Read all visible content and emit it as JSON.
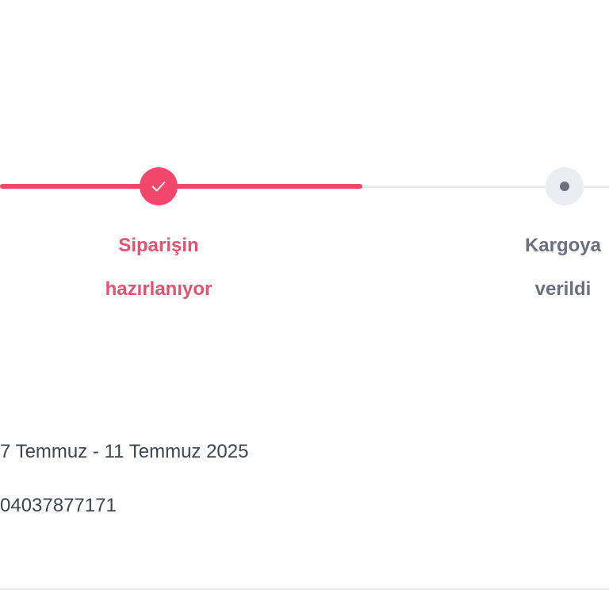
{
  "tracker": {
    "steps": [
      {
        "label_line1": "Siparişin",
        "label_line2": "hazırlanıyor",
        "status": "done",
        "icon": "check-icon"
      },
      {
        "label_line1": "Kargoya",
        "label_line2": "verildi",
        "status": "pending",
        "icon": "dot-icon"
      }
    ],
    "colors": {
      "active": "#f0476a",
      "inactive": "#e9e9ef",
      "label_active": "#e8506e",
      "label_inactive": "#6b6f80"
    }
  },
  "info": {
    "delivery_range": "7 Temmuz - 11 Temmuz 2025",
    "order_number": "04037877171"
  }
}
